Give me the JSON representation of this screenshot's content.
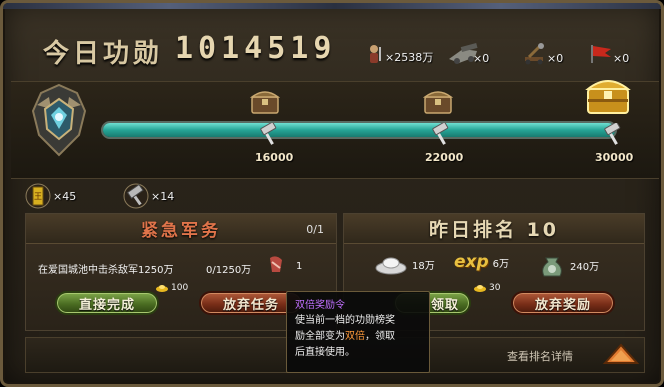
{
  "header": {
    "merit_label": "今日功勋",
    "merit_value": "1014519",
    "resources": [
      {
        "icon": "soldier-icon",
        "value": "×2538万"
      },
      {
        "icon": "cannon-icon",
        "value": "×0"
      },
      {
        "icon": "catapult-icon",
        "value": "×0"
      },
      {
        "icon": "flag-icon",
        "value": "×0"
      }
    ]
  },
  "progress": {
    "fill_fraction": 1.0,
    "milestones": [
      {
        "value": "16000",
        "chest": "treasure-chest-icon"
      },
      {
        "value": "22000",
        "chest": "treasure-chest-icon"
      },
      {
        "value": "30000",
        "chest": "gold-treasure-chest-icon"
      }
    ]
  },
  "items": [
    {
      "icon": "token-icon",
      "count": "×45"
    },
    {
      "icon": "hammer-icon",
      "count": "×14"
    }
  ],
  "urgent": {
    "title": "紧急军务",
    "progress": "0/1",
    "task_text": "在爱国城池中击杀敌军1250万",
    "task_progress": "0/1250万",
    "reward_count": "1",
    "complete_button": "直接完成",
    "complete_cost": "100",
    "abandon_button": "放弃任务"
  },
  "ranking": {
    "title": "昨日排名 10",
    "rewards": [
      {
        "icon": "silver-ingot-icon",
        "value": "18万"
      },
      {
        "icon": "exp-icon",
        "label": "exp",
        "value": "6万"
      },
      {
        "icon": "money-bag-icon",
        "value": "240万"
      }
    ],
    "claim_partial": "领取",
    "claim_cost": "30",
    "abandon_reward_button": "放弃奖励",
    "rank_detail_link": "查看排名详情"
  },
  "tooltip": {
    "title": "双倍奖励令",
    "line1": "使当前一档的功勋榜奖",
    "line2_pre": "励全部变为",
    "line2_hl": "双倍",
    "line2_post": "，领取",
    "line3": "后直接使用。"
  }
}
